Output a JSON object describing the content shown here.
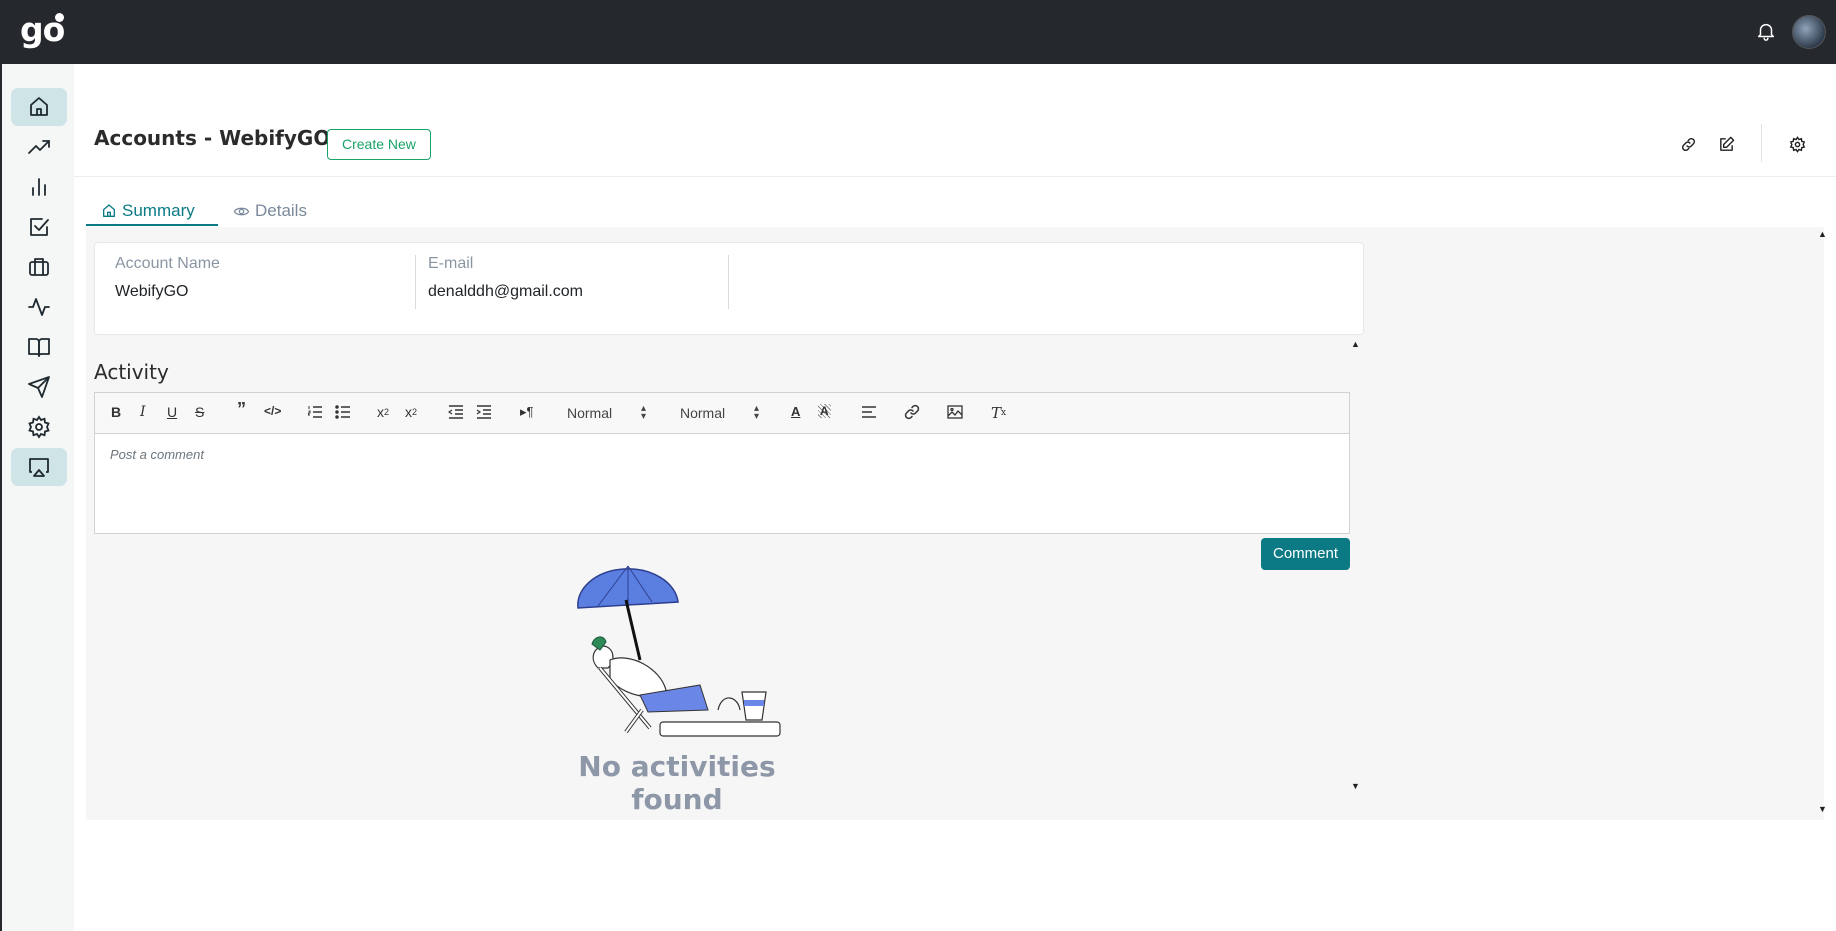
{
  "app": {
    "logo": "go"
  },
  "header": {
    "title": "Accounts - WebifyGO",
    "create_label": "Create New"
  },
  "tabs": [
    {
      "label": "Summary",
      "icon": "home-icon",
      "active": true
    },
    {
      "label": "Details",
      "icon": "eye-icon",
      "active": false
    }
  ],
  "sidebar": {
    "items": [
      {
        "icon": "home-icon",
        "active": true
      },
      {
        "icon": "trending-up-icon",
        "active": false
      },
      {
        "icon": "bar-chart-icon",
        "active": false
      },
      {
        "icon": "checkbox-icon",
        "active": false
      },
      {
        "icon": "briefcase-icon",
        "active": false
      },
      {
        "icon": "activity-icon",
        "active": false
      },
      {
        "icon": "book-icon",
        "active": false
      },
      {
        "icon": "send-icon",
        "active": false
      },
      {
        "icon": "gear-icon",
        "active": false
      },
      {
        "icon": "airplay-icon",
        "active": true
      }
    ]
  },
  "summary": {
    "account_name_label": "Account Name",
    "account_name_value": "WebifyGO",
    "email_label": "E-mail",
    "email_value": "denalddh@gmail.com"
  },
  "activity": {
    "title": "Activity",
    "placeholder": "Post a comment",
    "header_select": "Normal",
    "size_select": "Normal",
    "comment_label": "Comment",
    "empty_text": "No activities found"
  },
  "colors": {
    "accent": "#0b7a85",
    "create": "#1aa36b",
    "topbar": "#25282c"
  }
}
